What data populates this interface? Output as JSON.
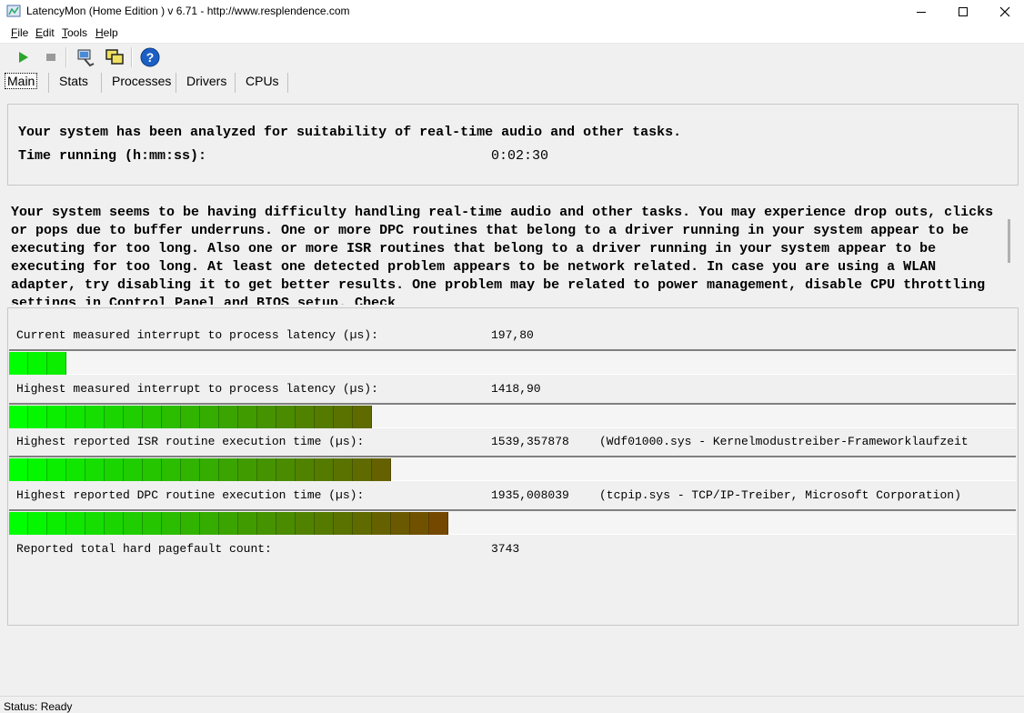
{
  "window": {
    "title": "LatencyMon  (Home Edition )  v 6.71 - http://www.resplendence.com"
  },
  "menu": [
    {
      "label": "File",
      "key": "F",
      "rest": "ile"
    },
    {
      "label": "Edit",
      "key": "E",
      "rest": "dit"
    },
    {
      "label": "Tools",
      "key": "T",
      "rest": "ools"
    },
    {
      "label": "Help",
      "key": "H",
      "rest": "elp"
    }
  ],
  "toolbar": {
    "icons": [
      "play-icon",
      "stop-icon",
      "monitor-icon",
      "windows-icon",
      "help-icon"
    ],
    "colors": {
      "play": "#2aa52a",
      "stop": "#9a9a9a",
      "help": "#1c5fc4"
    }
  },
  "tabs": [
    "Main",
    "Stats",
    "Processes",
    "Drivers",
    "CPUs"
  ],
  "summary": {
    "headline": "Your system has been analyzed for suitability of real-time audio and other tasks.",
    "time_label": "Time running (h:mm:ss):",
    "time_value": "0:02:30"
  },
  "message": "Your system seems to be having difficulty handling real-time audio and other tasks. You may experience drop outs, clicks or pops due to buffer underruns. One or more DPC routines that belong to a driver running in your system appear to be executing for too long. Also one or more ISR routines that belong to a driver running in your system appear to be executing for too long. At least one detected problem appears to be network related. In case you are using a WLAN adapter, try disabling it to get better results. One problem may be related to power management, disable CPU throttling settings in Control Panel and BIOS setup. Check",
  "metrics": [
    {
      "label": "Current measured interrupt to process latency (µs):",
      "value": "197,80",
      "detail": "",
      "bar_segments": 3
    },
    {
      "label": "Highest measured interrupt to process latency (µs):",
      "value": "1418,90",
      "detail": "",
      "bar_segments": 19
    },
    {
      "label": "Highest reported ISR routine execution time (µs):",
      "value": "1539,357878",
      "detail": "(Wdf01000.sys - Kernelmodustreiber-Frameworklaufzeit",
      "bar_segments": 20
    },
    {
      "label": "Highest reported DPC routine execution time (µs):",
      "value": "1935,008039",
      "detail": "(tcpip.sys - TCP/IP-Treiber, Microsoft Corporation)",
      "bar_segments": 23
    }
  ],
  "pagefault": {
    "label": "Reported total hard pagefault count:",
    "value": "3743"
  },
  "status": "Status: Ready",
  "colors": {
    "bar_start": "#00ff00",
    "bar_end": "#7a4000",
    "bar_track": "#f5f5f5"
  }
}
